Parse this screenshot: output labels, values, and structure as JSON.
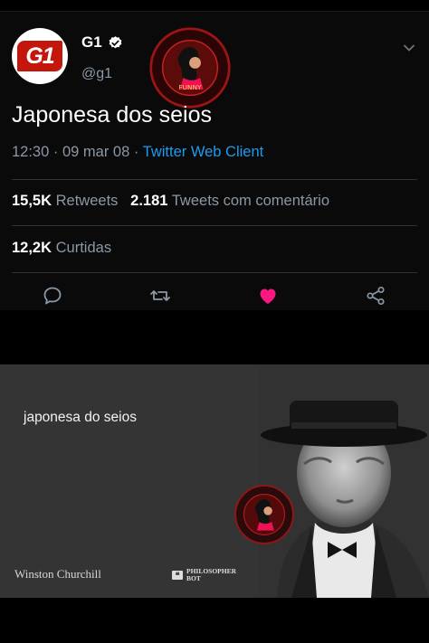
{
  "tweet": {
    "avatar_logo_text": "G1",
    "display_name": "G1",
    "handle": "@g1",
    "text": "Japonesa dos seios",
    "time": "12:30",
    "date": "09 mar 08",
    "client": "Twitter Web Client",
    "stats": {
      "retweets_count": "15,5K",
      "retweets_label": "Retweets",
      "quote_count": "2.181",
      "quote_label": "Tweets com comentário",
      "likes_count": "12,2K",
      "likes_label": "Curtidas"
    },
    "colors": {
      "like": "#f91880",
      "link": "#1d9bf0",
      "verified": "#ffffff"
    },
    "icons": [
      "reply-icon",
      "retweet-icon",
      "like-icon",
      "share-icon",
      "chevron-down-icon",
      "verified-badge-icon"
    ]
  },
  "watermark": {
    "text": "PODRÃO · NÃO · SENADO · CONGRESSO · AO · CABEÇA · FUNNY",
    "center_text": "FUNNY"
  },
  "meme": {
    "quote": "japonesa do seios",
    "author": "Winston Churchill",
    "brand_line1": "PHILOSOPHER",
    "brand_line2": "BOT",
    "brand_icon": "❝"
  }
}
